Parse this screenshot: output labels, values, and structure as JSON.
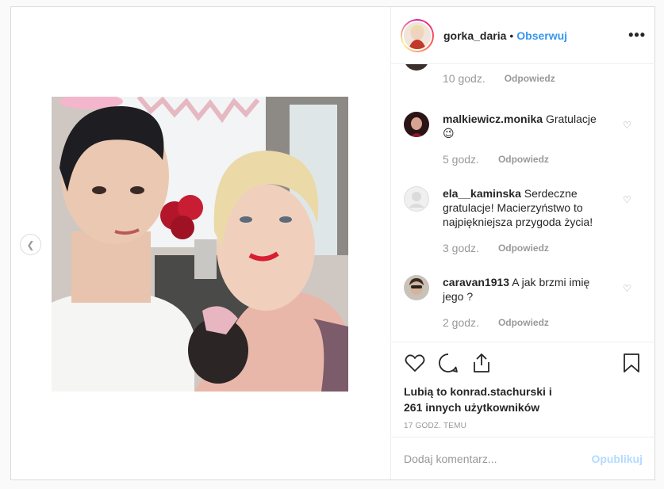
{
  "header": {
    "username": "gorka_daria",
    "separator": "•",
    "follow_label": "Obserwuj",
    "more_icon": "more-horizontal-icon"
  },
  "comments": {
    "partial": {
      "time": "10 godz.",
      "reply": "Odpowiedz"
    },
    "items": [
      {
        "user": "malkiewicz.monika",
        "text": "Gratulacje",
        "emoji": "😉",
        "time": "5 godz.",
        "reply": "Odpowiedz"
      },
      {
        "user": "ela__kaminska",
        "text": "Serdeczne gratulacje! Macierzyństwo to najpiękniejsza przygoda życia!",
        "time": "3 godz.",
        "reply": "Odpowiedz"
      },
      {
        "user": "caravan1913",
        "text": "A jak brzmi imię jego ?",
        "time": "2 godz.",
        "reply": "Odpowiedz"
      }
    ]
  },
  "actions": {
    "likes_line1": "Lubią to konrad.stachurski i",
    "likes_line2": "261 innych użytkowników",
    "timestamp": "17 GODZ. TEMU"
  },
  "composer": {
    "placeholder": "Dodaj komentarz...",
    "publish_label": "Opublikuj"
  },
  "colors": {
    "accent": "#3897f0",
    "publish_disabled": "#b3dbff",
    "muted": "#999999"
  }
}
